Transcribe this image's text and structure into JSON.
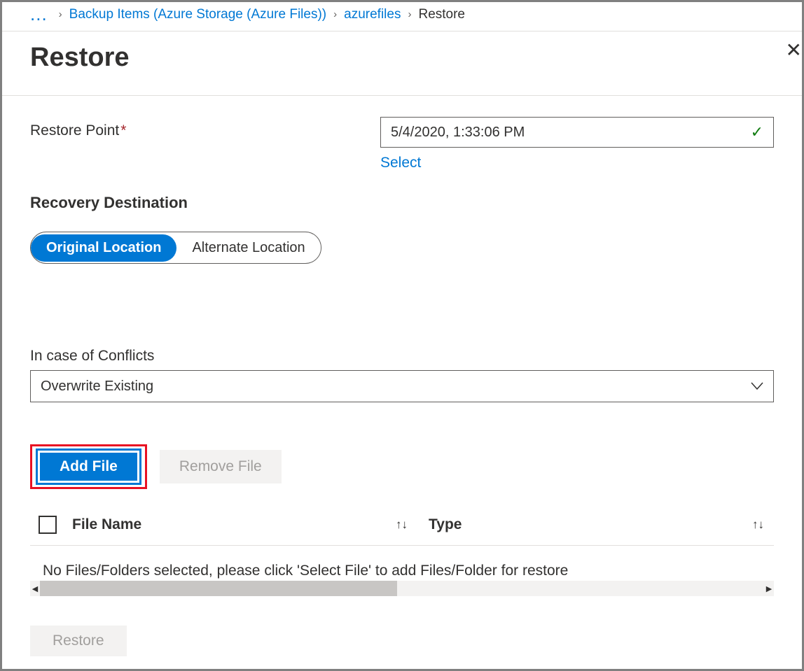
{
  "breadcrumb": {
    "ellipsis": "...",
    "items": [
      {
        "label": "Backup Items (Azure Storage (Azure Files))",
        "link": true
      },
      {
        "label": "azurefiles",
        "link": true
      },
      {
        "label": "Restore",
        "link": false
      }
    ]
  },
  "header": {
    "title": "Restore"
  },
  "restore_point": {
    "label": "Restore Point",
    "value": "5/4/2020, 1:33:06 PM",
    "select_link": "Select"
  },
  "recovery": {
    "title": "Recovery Destination",
    "options": [
      "Original Location",
      "Alternate Location"
    ],
    "selected": "Original Location"
  },
  "conflicts": {
    "label": "In case of Conflicts",
    "value": "Overwrite Existing"
  },
  "buttons": {
    "add_file": "Add File",
    "remove_file": "Remove File"
  },
  "table": {
    "col_file": "File Name",
    "col_type": "Type",
    "empty_msg": "No Files/Folders selected, please click 'Select File' to add Files/Folder for restore"
  },
  "footer": {
    "restore": "Restore"
  }
}
